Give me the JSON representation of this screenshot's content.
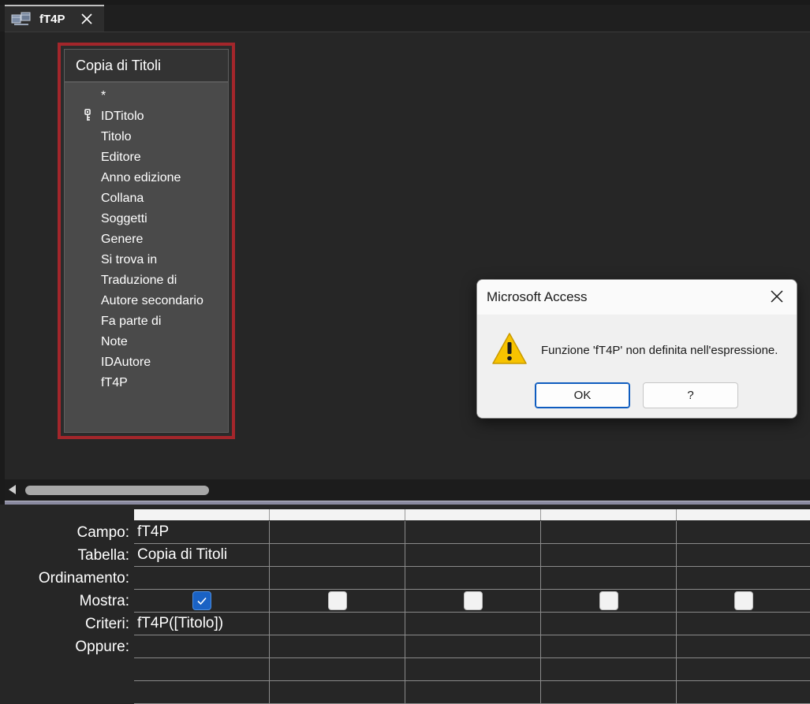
{
  "tab": {
    "title": "fT4P",
    "icon": "query-icon",
    "close_icon": "close-icon"
  },
  "table": {
    "name": "Copia di Titoli",
    "fields": [
      {
        "label": "*",
        "key": false
      },
      {
        "label": "IDTitolo",
        "key": true
      },
      {
        "label": "Titolo",
        "key": false
      },
      {
        "label": "Editore",
        "key": false
      },
      {
        "label": "Anno edizione",
        "key": false
      },
      {
        "label": "Collana",
        "key": false
      },
      {
        "label": "Soggetti",
        "key": false
      },
      {
        "label": "Genere",
        "key": false
      },
      {
        "label": "Si trova in",
        "key": false
      },
      {
        "label": "Traduzione di",
        "key": false
      },
      {
        "label": "Autore secondario",
        "key": false
      },
      {
        "label": "Fa parte di",
        "key": false
      },
      {
        "label": "Note",
        "key": false
      },
      {
        "label": "IDAutore",
        "key": false
      },
      {
        "label": "fT4P",
        "key": false
      }
    ]
  },
  "grid": {
    "row_labels": [
      "Campo:",
      "Tabella:",
      "Ordinamento:",
      "Mostra:",
      "Criteri:",
      "Oppure:"
    ],
    "columns": [
      {
        "campo": "fT4P",
        "tabella": "Copia di Titoli",
        "ordinamento": "",
        "mostra": true,
        "criteri": "fT4P([Titolo])",
        "oppure": ""
      },
      {
        "campo": "",
        "tabella": "",
        "ordinamento": "",
        "mostra": false,
        "criteri": "",
        "oppure": ""
      },
      {
        "campo": "",
        "tabella": "",
        "ordinamento": "",
        "mostra": false,
        "criteri": "",
        "oppure": ""
      },
      {
        "campo": "",
        "tabella": "",
        "ordinamento": "",
        "mostra": false,
        "criteri": "",
        "oppure": ""
      },
      {
        "campo": "",
        "tabella": "",
        "ordinamento": "",
        "mostra": false,
        "criteri": "",
        "oppure": ""
      }
    ]
  },
  "dialog": {
    "title": "Microsoft Access",
    "message": "Funzione 'fT4P' non definita nell'espressione.",
    "ok_label": "OK",
    "help_label": "?",
    "icon": "warning-icon"
  },
  "colors": {
    "background": "#262626",
    "table_border": "#a3262b",
    "field_list_bg": "#4a4a4a",
    "checkbox_checked": "#1a62c4",
    "dialog_bg": "#f0f0f0",
    "warning": "#f7c300"
  }
}
